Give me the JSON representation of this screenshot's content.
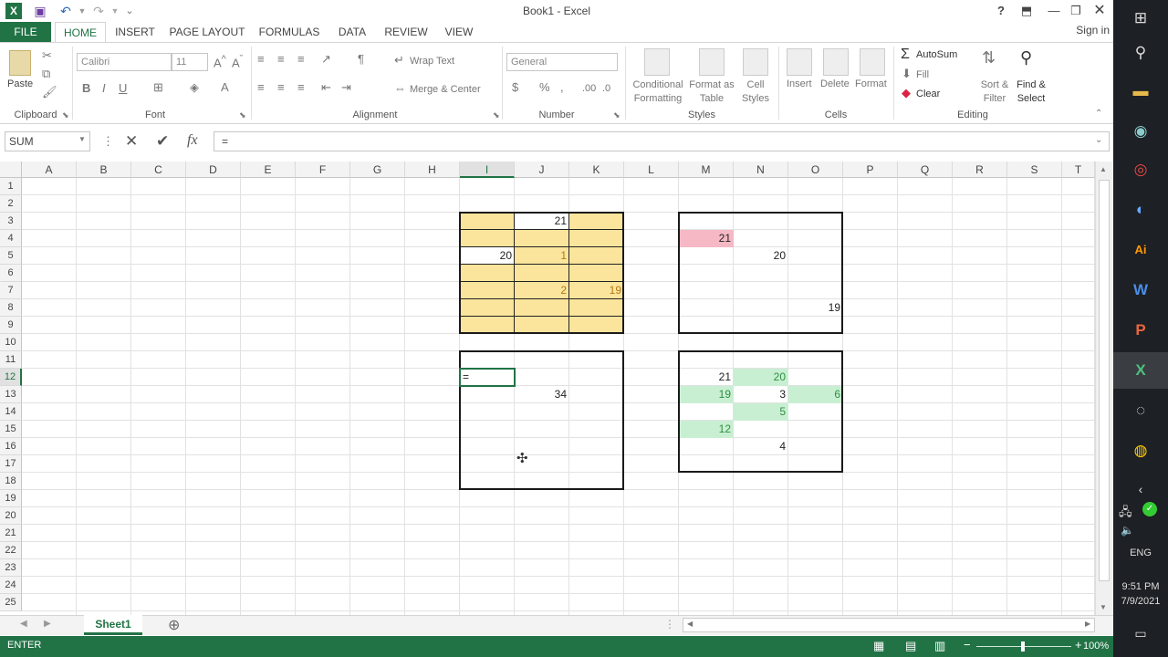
{
  "window": {
    "title": "Book1 - Excel",
    "help": "?",
    "minimize": "—",
    "restore": "❐",
    "close": "✕"
  },
  "quick_access": {
    "excel_logo": "X",
    "save": "💾",
    "undo": "↶",
    "redo": "↷",
    "customize": "⌄"
  },
  "tabs": [
    "FILE",
    "HOME",
    "INSERT",
    "PAGE LAYOUT",
    "FORMULAS",
    "DATA",
    "REVIEW",
    "VIEW"
  ],
  "active_tab": "HOME",
  "signin": "Sign in",
  "ribbon": {
    "clipboard": {
      "label": "Clipboard",
      "paste": "Paste"
    },
    "font": {
      "label": "Font",
      "font_name": "Calibri",
      "font_size": "11",
      "bold": "B",
      "italic": "I",
      "underline": "U"
    },
    "alignment": {
      "label": "Alignment",
      "wrap_text": "Wrap Text",
      "merge_center": "Merge & Center"
    },
    "number": {
      "label": "Number",
      "format": "General",
      "currency": "$",
      "percent": "%"
    },
    "styles": {
      "label": "Styles",
      "conditional": "Conditional\nFormatting",
      "format_table": "Format as\nTable",
      "cell_styles": "Cell\nStyles"
    },
    "cells": {
      "label": "Cells",
      "insert": "Insert",
      "delete": "Delete",
      "format": "Format"
    },
    "editing": {
      "label": "Editing",
      "autosum": "AutoSum",
      "fill": "Fill",
      "clear": "Clear",
      "sort_filter": "Sort &\nFilter",
      "find_select": "Find &\nSelect"
    }
  },
  "formula_bar": {
    "name_box": "SUM",
    "cancel": "✕",
    "enter": "✔",
    "fx": "fx",
    "content": "="
  },
  "columns": [
    "A",
    "B",
    "C",
    "D",
    "E",
    "F",
    "G",
    "H",
    "I",
    "J",
    "K",
    "L",
    "M",
    "N",
    "O",
    "P",
    "Q",
    "R",
    "S",
    "T"
  ],
  "rows": [
    "1",
    "2",
    "3",
    "4",
    "5",
    "6",
    "7",
    "8",
    "9",
    "10",
    "11",
    "12",
    "13",
    "14",
    "15",
    "16",
    "17",
    "18",
    "19",
    "20",
    "21",
    "22",
    "23",
    "24",
    "25"
  ],
  "cells": [
    {
      "ref": "J3",
      "value": "21"
    },
    {
      "ref": "I5",
      "value": "20"
    },
    {
      "ref": "J5",
      "value": "1"
    },
    {
      "ref": "J7",
      "value": "2"
    },
    {
      "ref": "K7",
      "value": "19"
    },
    {
      "ref": "M4",
      "value": "21"
    },
    {
      "ref": "N5",
      "value": "20"
    },
    {
      "ref": "O8",
      "value": "19"
    },
    {
      "ref": "I12",
      "value": "="
    },
    {
      "ref": "J13",
      "value": "34"
    },
    {
      "ref": "M12",
      "value": "21"
    },
    {
      "ref": "N12",
      "value": "20"
    },
    {
      "ref": "M13",
      "value": "19"
    },
    {
      "ref": "N13",
      "value": "3"
    },
    {
      "ref": "O13",
      "value": "6"
    },
    {
      "ref": "N14",
      "value": "5"
    },
    {
      "ref": "M15",
      "value": "12"
    },
    {
      "ref": "N16",
      "value": "4"
    }
  ],
  "colors": {
    "excel_green": "#217346",
    "yellow_fill": "#fbe59c",
    "pink_fill": "#f5b8c4",
    "green_fill": "#c9efd3",
    "green_text": "#2f8f3f",
    "brown_text": "#b07a12"
  },
  "sheet_tabs": [
    "Sheet1"
  ],
  "status": {
    "mode": "ENTER",
    "zoom": "100%"
  },
  "taskbar": {
    "time": "9:51 PM",
    "date": "7/9/2021",
    "language": "ENG"
  }
}
